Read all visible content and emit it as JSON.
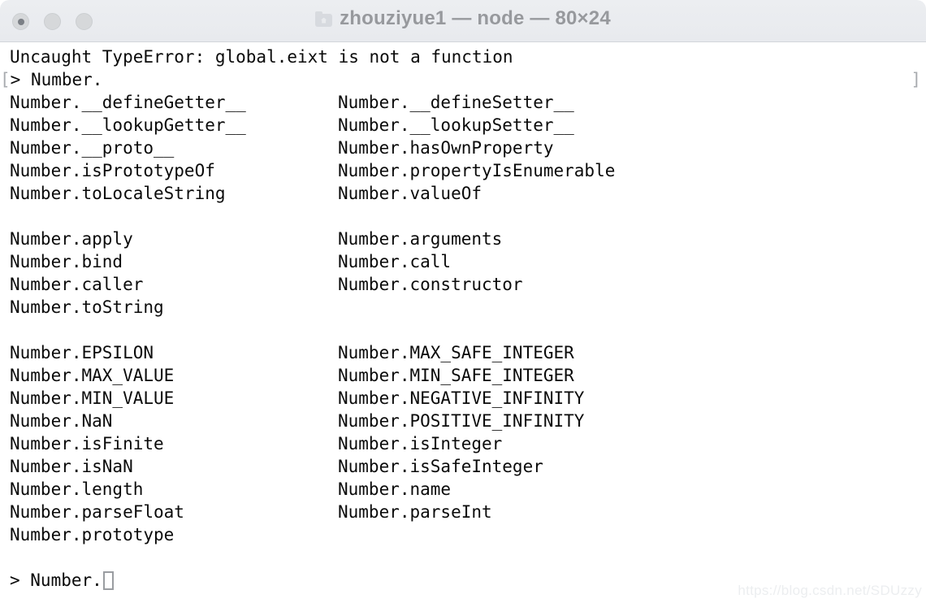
{
  "window": {
    "title": "zhouziyue1 — node — 80×24",
    "folder_icon": "folder-home-icon",
    "traffic_lights": [
      {
        "name": "close-button",
        "label": "Close"
      },
      {
        "name": "minimize-button",
        "label": "Minimize"
      },
      {
        "name": "zoom-button",
        "label": "Zoom"
      }
    ]
  },
  "terminal": {
    "error_line": "Uncaught TypeError: global.eixt is not a function",
    "echo_prompt": "> Number.",
    "left_artifact": "[",
    "right_artifact": "]",
    "completion_groups": [
      {
        "rows": [
          {
            "col1": "Number.__defineGetter__",
            "col2": "Number.__defineSetter__"
          },
          {
            "col1": "Number.__lookupGetter__",
            "col2": "Number.__lookupSetter__"
          },
          {
            "col1": "Number.__proto__",
            "col2": "Number.hasOwnProperty"
          },
          {
            "col1": "Number.isPrototypeOf",
            "col2": "Number.propertyIsEnumerable"
          },
          {
            "col1": "Number.toLocaleString",
            "col2": "Number.valueOf"
          }
        ]
      },
      {
        "rows": [
          {
            "col1": "Number.apply",
            "col2": "Number.arguments"
          },
          {
            "col1": "Number.bind",
            "col2": "Number.call"
          },
          {
            "col1": "Number.caller",
            "col2": "Number.constructor"
          },
          {
            "col1": "Number.toString",
            "col2": ""
          }
        ]
      },
      {
        "rows": [
          {
            "col1": "Number.EPSILON",
            "col2": "Number.MAX_SAFE_INTEGER"
          },
          {
            "col1": "Number.MAX_VALUE",
            "col2": "Number.MIN_SAFE_INTEGER"
          },
          {
            "col1": "Number.MIN_VALUE",
            "col2": "Number.NEGATIVE_INFINITY"
          },
          {
            "col1": "Number.NaN",
            "col2": "Number.POSITIVE_INFINITY"
          },
          {
            "col1": "Number.isFinite",
            "col2": "Number.isInteger"
          },
          {
            "col1": "Number.isNaN",
            "col2": "Number.isSafeInteger"
          },
          {
            "col1": "Number.length",
            "col2": "Number.name"
          },
          {
            "col1": "Number.parseFloat",
            "col2": "Number.parseInt"
          },
          {
            "col1": "Number.prototype",
            "col2": ""
          }
        ]
      }
    ],
    "prompt": "> Number.",
    "cursor": "block-cursor"
  },
  "watermark": "https://blog.csdn.net/SDUzzy",
  "colors": {
    "titlebar": "#e9ebee",
    "title_text": "#97999d",
    "terminal_bg": "#ffffff",
    "terminal_text": "#0a0a0a",
    "artifact": "#a8abaf",
    "watermark": "#eceef0"
  }
}
